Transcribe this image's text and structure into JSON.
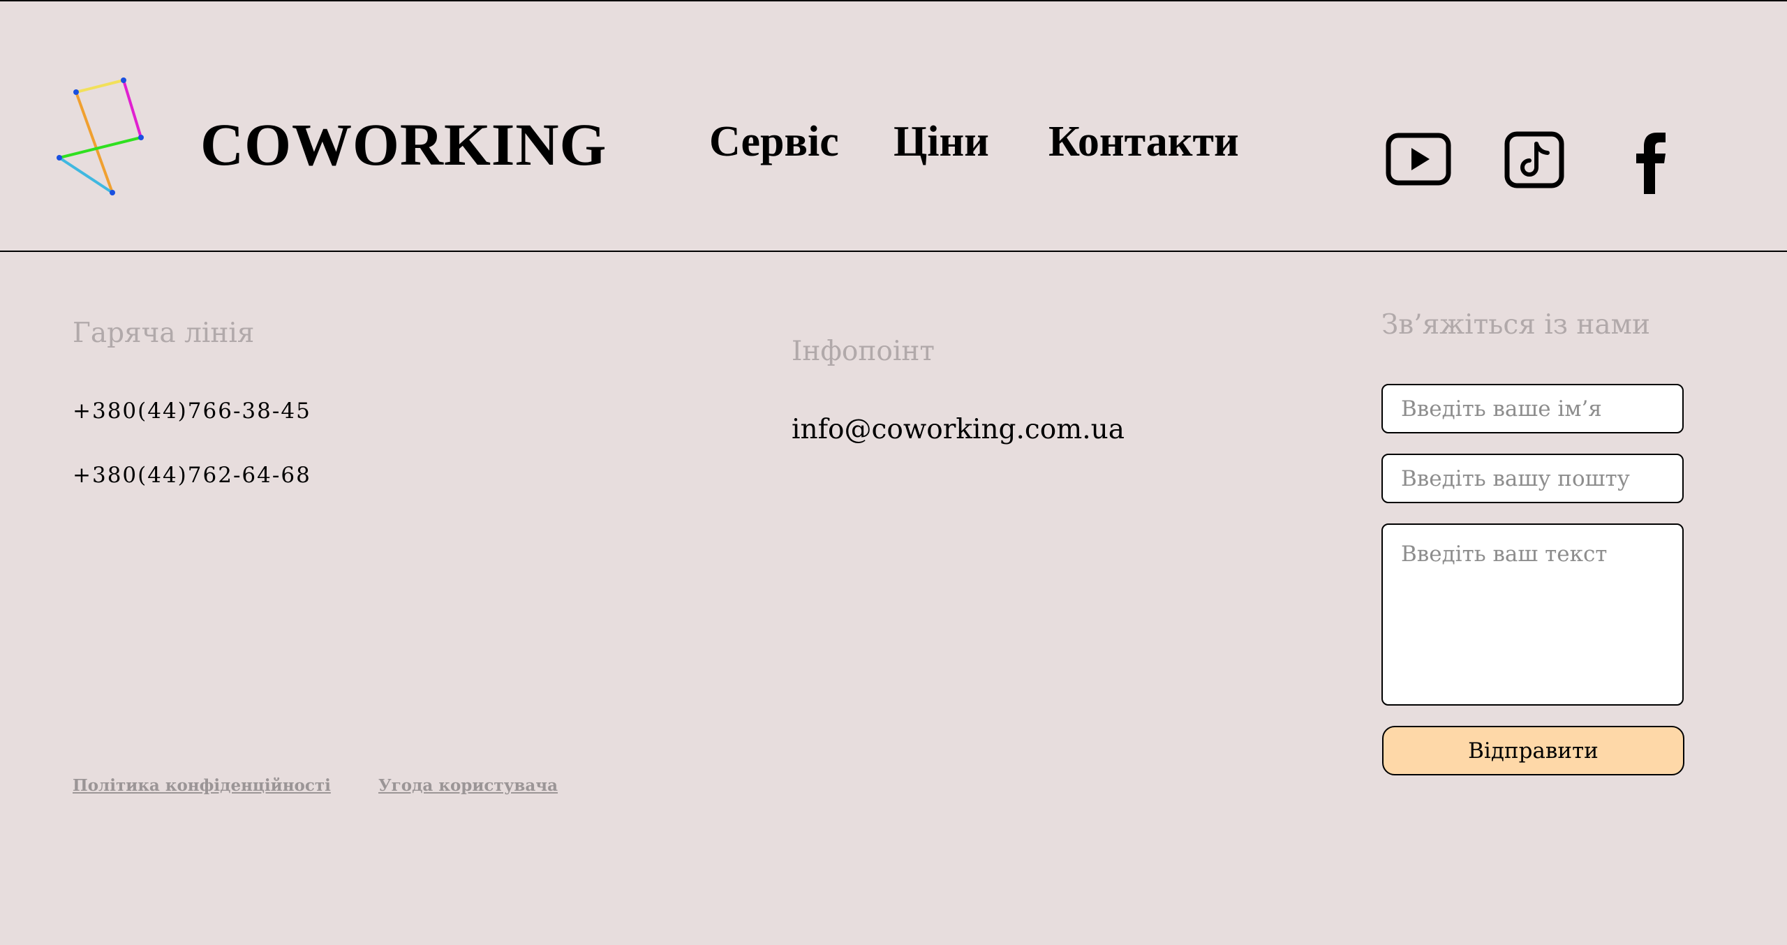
{
  "header": {
    "brand": "COWORKING",
    "nav": [
      "Сервіс",
      "Ціни",
      "Контакти"
    ],
    "social_icons": [
      "youtube-icon",
      "tiktok-icon",
      "facebook-icon"
    ]
  },
  "hotline": {
    "title": "Гаряча лінія",
    "phones": [
      "+380(44)766-38-45",
      "+380(44)762-64-68"
    ]
  },
  "infopoint": {
    "title": "Інфопоінт",
    "email": "info@coworking.com.ua"
  },
  "contact_form": {
    "title": "Зв’яжіться із нами",
    "name_placeholder": "Введіть ваше ім’я",
    "email_placeholder": "Введіть вашу пошту",
    "text_placeholder": "Введіть ваш текст",
    "submit_label": "Відправити"
  },
  "footer_links": [
    "Політика конфіденційності",
    "Угода користувача"
  ],
  "colors": {
    "background": "#e7dddd",
    "button": "#fed8a8",
    "muted_text": "#b1a9aa",
    "logo_yellow": "#f2e05a",
    "logo_magenta": "#e020d0",
    "logo_orange": "#f0a030",
    "logo_green": "#30e020",
    "logo_cyan": "#40b8e0",
    "logo_nodes": "#1a50e0"
  }
}
